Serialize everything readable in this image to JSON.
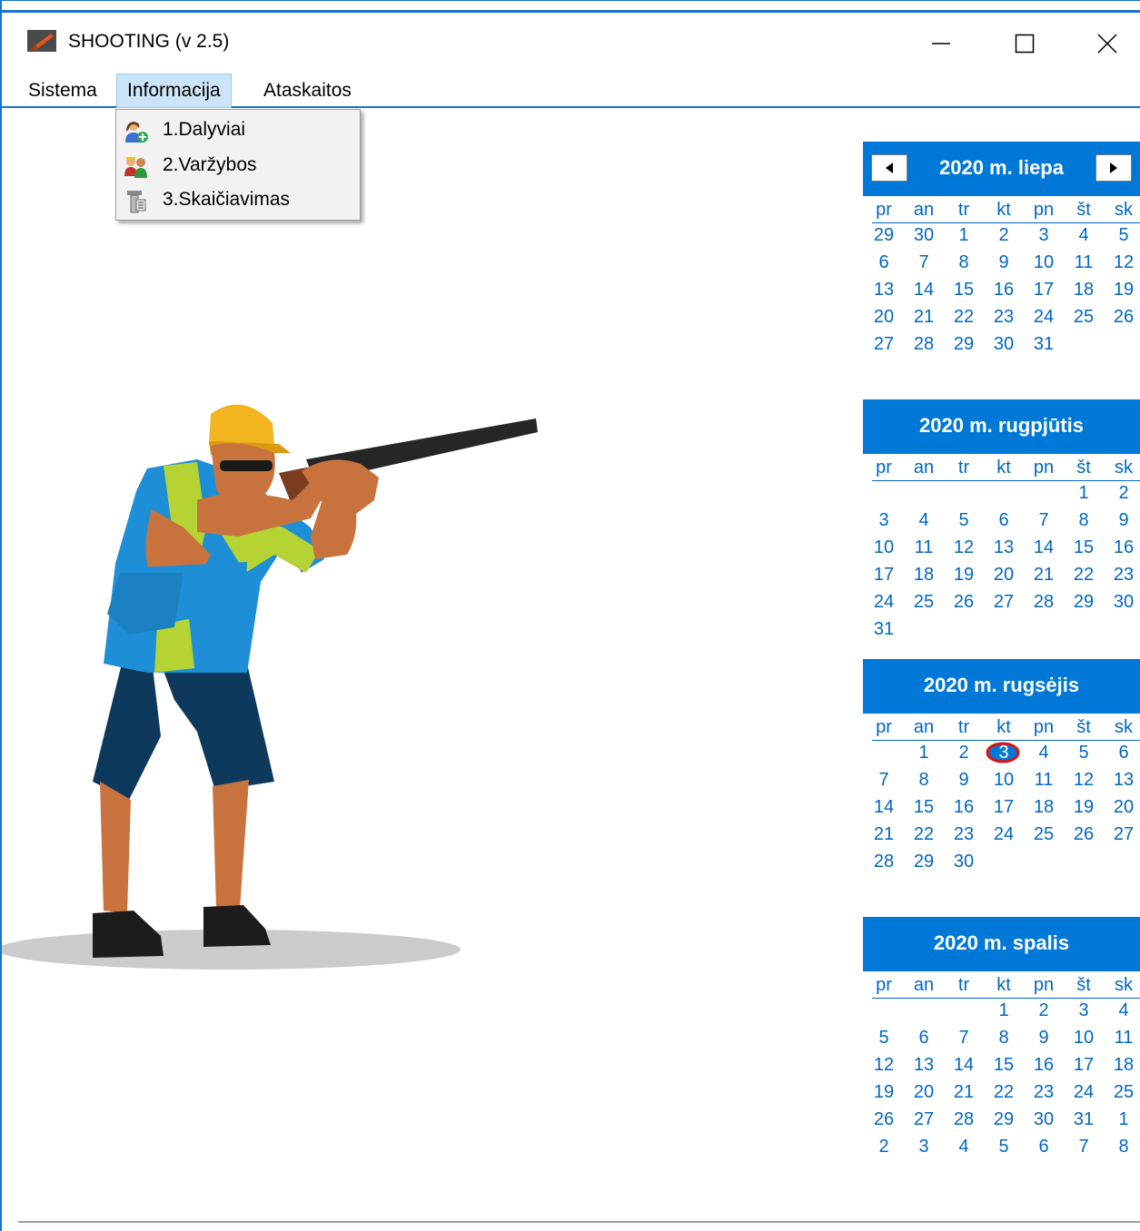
{
  "window": {
    "title": "SHOOTING (v 2.5)",
    "accent_color": "#0078d7"
  },
  "menubar": {
    "items": [
      {
        "label": "Sistema"
      },
      {
        "label": "Informacija"
      },
      {
        "label": "Ataskaitos"
      }
    ]
  },
  "dropdown": {
    "items": [
      {
        "label": "1.Dalyviai",
        "icon": "users-add-icon"
      },
      {
        "label": "2.Varžybos",
        "icon": "competition-icon"
      },
      {
        "label": "3.Skaičiavimas",
        "icon": "calculation-icon"
      }
    ]
  },
  "calendar": {
    "day_names": [
      "pr",
      "an",
      "tr",
      "kt",
      "pn",
      "št",
      "sk"
    ],
    "months": [
      {
        "title": "2020 m. liepa",
        "weeks": [
          [
            "29",
            "30",
            "1",
            "2",
            "3",
            "4",
            "5"
          ],
          [
            "6",
            "7",
            "8",
            "9",
            "10",
            "11",
            "12"
          ],
          [
            "13",
            "14",
            "15",
            "16",
            "17",
            "18",
            "19"
          ],
          [
            "20",
            "21",
            "22",
            "23",
            "24",
            "25",
            "26"
          ],
          [
            "27",
            "28",
            "29",
            "30",
            "31",
            "",
            ""
          ]
        ]
      },
      {
        "title": "2020 m. rugpjūtis",
        "weeks": [
          [
            "",
            "",
            "",
            "",
            "",
            "1",
            "2"
          ],
          [
            "3",
            "4",
            "5",
            "6",
            "7",
            "8",
            "9"
          ],
          [
            "10",
            "11",
            "12",
            "13",
            "14",
            "15",
            "16"
          ],
          [
            "17",
            "18",
            "19",
            "20",
            "21",
            "22",
            "23"
          ],
          [
            "24",
            "25",
            "26",
            "27",
            "28",
            "29",
            "30"
          ],
          [
            "31",
            "",
            "",
            "",
            "",
            "",
            ""
          ]
        ]
      },
      {
        "title": "2020 m. rugsėjis",
        "today": "3",
        "weeks": [
          [
            "",
            "1",
            "2",
            "3",
            "4",
            "5",
            "6"
          ],
          [
            "7",
            "8",
            "9",
            "10",
            "11",
            "12",
            "13"
          ],
          [
            "14",
            "15",
            "16",
            "17",
            "18",
            "19",
            "20"
          ],
          [
            "21",
            "22",
            "23",
            "24",
            "25",
            "26",
            "27"
          ],
          [
            "28",
            "29",
            "30",
            "",
            "",
            "",
            ""
          ]
        ]
      },
      {
        "title": "2020 m. spalis",
        "weeks": [
          [
            "",
            "",
            "",
            "1",
            "2",
            "3",
            "4"
          ],
          [
            "5",
            "6",
            "7",
            "8",
            "9",
            "10",
            "11"
          ],
          [
            "12",
            "13",
            "14",
            "15",
            "16",
            "17",
            "18"
          ],
          [
            "19",
            "20",
            "21",
            "22",
            "23",
            "24",
            "25"
          ],
          [
            "26",
            "27",
            "28",
            "29",
            "30",
            "31",
            "1"
          ],
          [
            "2",
            "3",
            "4",
            "5",
            "6",
            "7",
            "8"
          ]
        ]
      }
    ]
  }
}
